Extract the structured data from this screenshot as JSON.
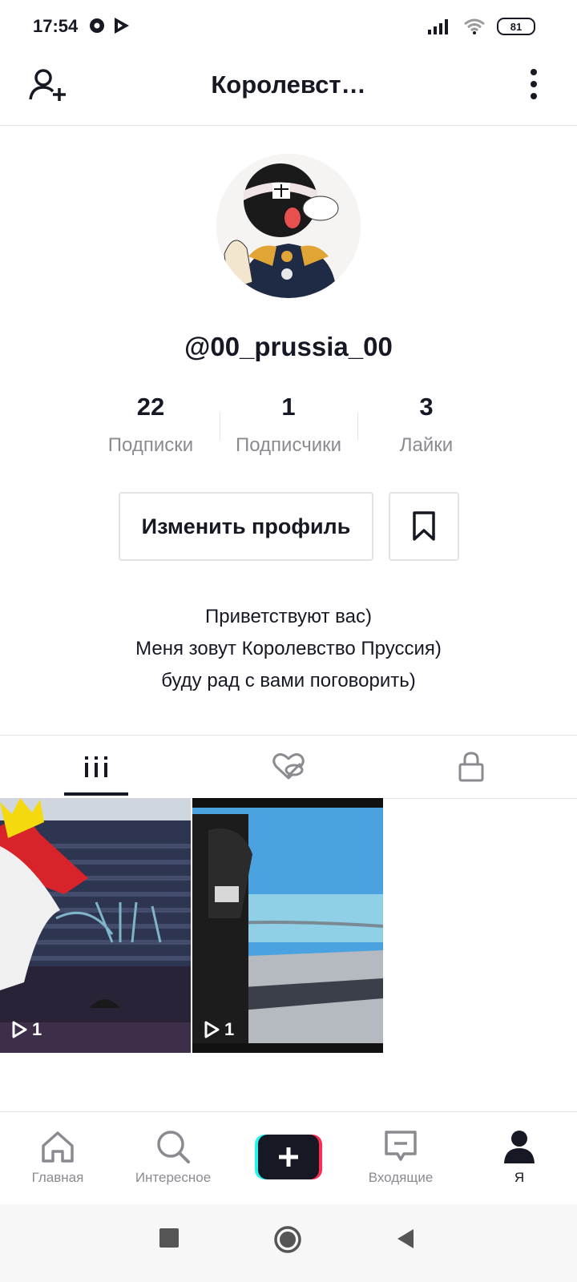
{
  "status_bar": {
    "time": "17:54",
    "battery": "81",
    "icons": [
      "notification-icon",
      "play-store-icon",
      "signal-icon",
      "wifi-icon",
      "battery-icon"
    ]
  },
  "header": {
    "title": "Королевст…",
    "add_user_icon": "add-user-icon",
    "more_icon": "more-vertical-icon"
  },
  "profile": {
    "username": "@00_prussia_00",
    "stats": [
      {
        "value": "22",
        "label": "Подписки"
      },
      {
        "value": "1",
        "label": "Подписчики"
      },
      {
        "value": "3",
        "label": "Лайки"
      }
    ],
    "edit_button": "Изменить профиль",
    "bio": [
      "Приветствуют вас)",
      "Меня зовут Королевство Пруссия)",
      "буду рад с вами поговорить)"
    ]
  },
  "tabs": {
    "items": [
      "videos-grid-icon",
      "liked-hidden-icon",
      "private-lock-icon"
    ],
    "active_index": 0
  },
  "videos": [
    {
      "views": "1"
    },
    {
      "views": "1"
    }
  ],
  "bottom_nav": {
    "items": [
      {
        "label": "Главная",
        "icon": "home-icon"
      },
      {
        "label": "Интересное",
        "icon": "search-icon"
      },
      {
        "label": "",
        "icon": "create-plus-icon"
      },
      {
        "label": "Входящие",
        "icon": "inbox-icon"
      },
      {
        "label": "Я",
        "icon": "profile-icon"
      }
    ],
    "active_index": 4
  },
  "colors": {
    "text_primary": "#161823",
    "text_secondary": "#8a8b91",
    "divider": "#e3e3e4",
    "create_cyan": "#25f4ee",
    "create_red": "#fe2c55"
  }
}
